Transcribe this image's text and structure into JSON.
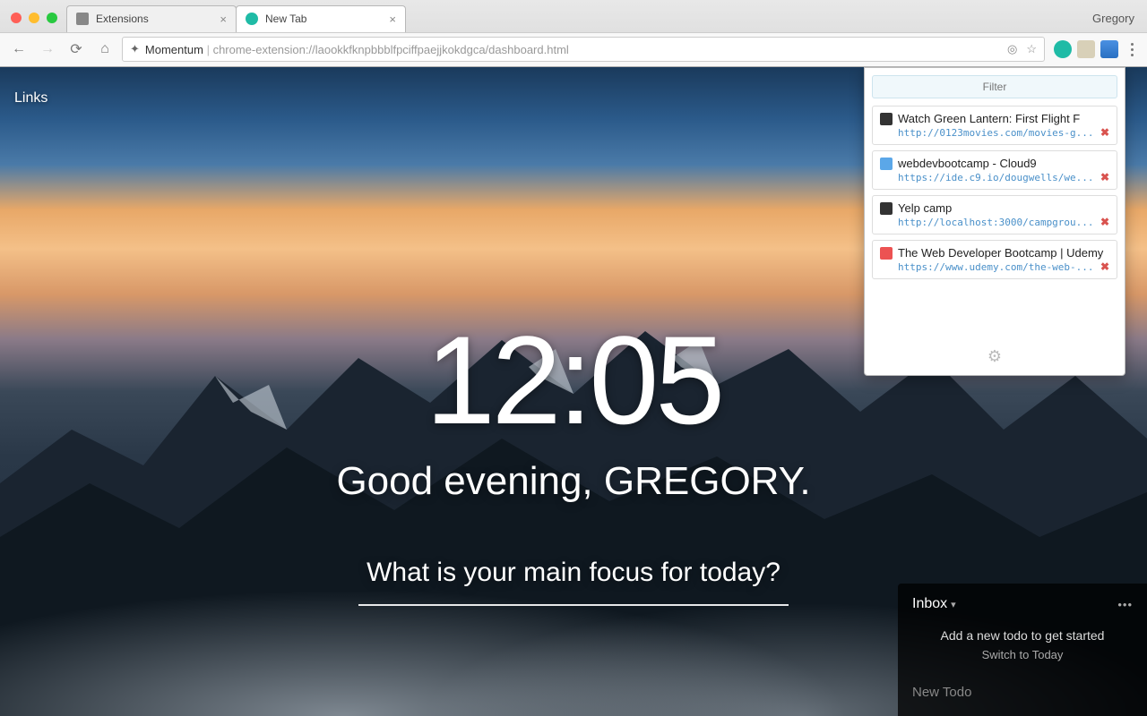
{
  "browser": {
    "profile": "Gregory",
    "tabs": [
      {
        "title": "Extensions",
        "favicon_color": "#888"
      },
      {
        "title": "New Tab",
        "favicon_color": "#1fbba6"
      }
    ],
    "address": {
      "prefix": "Momentum",
      "url": "chrome-extension://laookkfknpbbblfpciffpaejjkokdgca/dashboard.html"
    }
  },
  "momentum": {
    "links_label": "Links",
    "clock": "12:05",
    "greeting": "Good evening, GREGORY.",
    "focus_question": "What is your main focus for today?"
  },
  "ext_panel": {
    "filter_placeholder": "Filter",
    "items": [
      {
        "title": "Watch Green Lantern: First Flight F",
        "url": "http://0123movies.com/movies-g...",
        "fav": "#333"
      },
      {
        "title": "webdevbootcamp - Cloud9",
        "url": "https://ide.c9.io/dougwells/we...",
        "fav": "#5ba7e8"
      },
      {
        "title": "Yelp camp",
        "url": "http://localhost:3000/campgrou...",
        "fav": "#333"
      },
      {
        "title": "The Web Developer Bootcamp | Udemy",
        "url": "https://www.udemy.com/the-web-...",
        "fav": "#ec5252"
      }
    ]
  },
  "todo": {
    "heading": "Inbox",
    "empty_text": "Add a new todo to get started",
    "switch_text": "Switch to Today",
    "new_placeholder": "New Todo"
  }
}
